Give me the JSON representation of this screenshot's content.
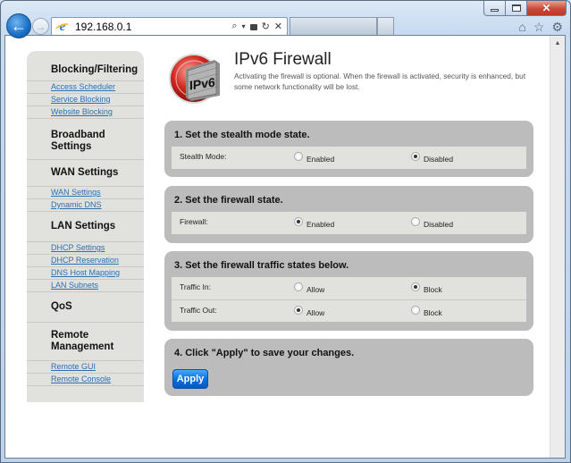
{
  "browser": {
    "url": "192.168.0.1",
    "caption_buttons": {
      "minimize": "minimize",
      "maximize": "maximize",
      "close": "✕"
    },
    "toolbar_icons": [
      "home-icon",
      "star-icon",
      "gear-icon"
    ],
    "address_tools": {
      "search": "⌕",
      "dropdown": "▾",
      "lock": "🔒",
      "refresh": "↻",
      "stop": "✕"
    }
  },
  "sidebar": {
    "sections": [
      {
        "title": "Blocking/Filtering",
        "links": [
          "Access Scheduler",
          "Service Blocking",
          "Website Blocking"
        ]
      },
      {
        "title": "Broadband Settings",
        "links": []
      },
      {
        "title": "WAN Settings",
        "links": [
          "WAN Settings",
          "Dynamic DNS"
        ]
      },
      {
        "title": "LAN Settings",
        "links": [
          "DHCP Settings",
          "DHCP Reservation",
          "DNS Host Mapping",
          "LAN Subnets"
        ]
      },
      {
        "title": "QoS",
        "links": []
      },
      {
        "title": "Remote Management",
        "links": [
          "Remote GUI",
          "Remote Console"
        ]
      }
    ]
  },
  "page": {
    "logo_text": "IPv6",
    "title": "IPv6 Firewall",
    "description": "Activating the firewall is optional. When the firewall is activated, security is enhanced, but some network functionality will be lost."
  },
  "panels": {
    "stealth": {
      "title": "1. Set the stealth mode state.",
      "rows": [
        {
          "label": "Stealth Mode:",
          "options": [
            "Enabled",
            "Disabled"
          ],
          "selected": "Disabled"
        }
      ]
    },
    "firewall": {
      "title": "2. Set the firewall state.",
      "rows": [
        {
          "label": "Firewall:",
          "options": [
            "Enabled",
            "Disabled"
          ],
          "selected": "Enabled"
        }
      ]
    },
    "traffic": {
      "title": "3. Set the firewall traffic states below.",
      "rows": [
        {
          "label": "Traffic In:",
          "options": [
            "Allow",
            "Block"
          ],
          "selected": "Block"
        },
        {
          "label": "Traffic Out:",
          "options": [
            "Allow",
            "Block"
          ],
          "selected": "Allow"
        }
      ]
    },
    "apply": {
      "title": "4. Click \"Apply\" to save your changes.",
      "button_label": "Apply"
    }
  }
}
